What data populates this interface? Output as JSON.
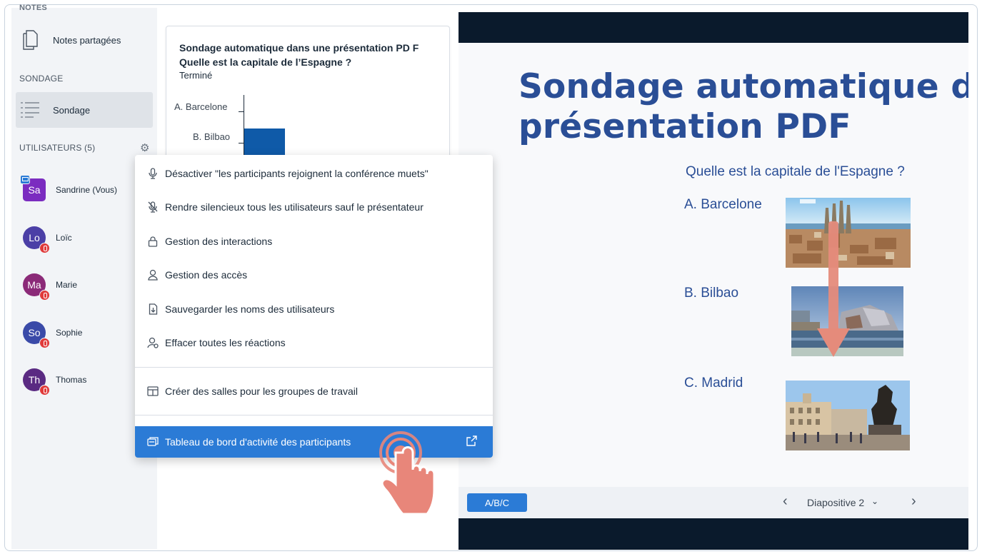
{
  "sidebar": {
    "notes_header": "NOTES",
    "shared_notes_label": "Notes partagées",
    "poll_header": "SONDAGE",
    "poll_label": "Sondage",
    "users_header": "UTILISATEURS (5)",
    "users": [
      {
        "initials": "Sa",
        "name": "Sandrine (Vous)",
        "color": "#7b2cc0",
        "presenter": true,
        "muted": false
      },
      {
        "initials": "Lo",
        "name": "Loïc",
        "color": "#4b3fa6",
        "presenter": false,
        "muted": true
      },
      {
        "initials": "Ma",
        "name": "Marie",
        "color": "#8b2a78",
        "presenter": false,
        "muted": true
      },
      {
        "initials": "So",
        "name": "Sophie",
        "color": "#3a4aa8",
        "presenter": false,
        "muted": true
      },
      {
        "initials": "Th",
        "name": "Thomas",
        "color": "#5a2a82",
        "presenter": false,
        "muted": true
      }
    ]
  },
  "poll": {
    "title": "Sondage automatique dans une présentation PD F Quelle est la capitale de l’Espagne ?",
    "status": "Terminé",
    "options": [
      "A. Barcelone",
      "B. Bilbao"
    ]
  },
  "menu": {
    "items": [
      {
        "icon": "microphone-icon",
        "label": "Désactiver \"les participants rejoignent la conférence muets\""
      },
      {
        "icon": "microphone-muted-icon",
        "label": "Rendre silencieux tous les utilisateurs sauf le présentateur"
      },
      {
        "icon": "lock-icon",
        "label": "Gestion des interactions"
      },
      {
        "icon": "user-icon",
        "label": "Gestion des accès"
      },
      {
        "icon": "download-file-icon",
        "label": "Sauvegarder les noms des utilisateurs"
      },
      {
        "icon": "clear-reactions-icon",
        "label": "Effacer toutes les réactions"
      },
      {
        "icon": "breakout-rooms-icon",
        "label": "Créer des salles pour les groupes de travail"
      },
      {
        "icon": "dashboard-icon",
        "label": "Tableau de bord d'activité des participants"
      }
    ]
  },
  "slide": {
    "title_line1": "Sondage automatique dan",
    "title_line2": "présentation PDF",
    "question": "Quelle est la capitale de l'Espagne ?",
    "option_a": "A.  Barcelone",
    "option_b": "B. Bilbao",
    "option_c": "C. Madrid",
    "title_color": "#2a4e96"
  },
  "toolbar": {
    "poll_button": "A/B/C",
    "slide_label": "Diapositive 2",
    "accent": "#2b7bd6"
  }
}
